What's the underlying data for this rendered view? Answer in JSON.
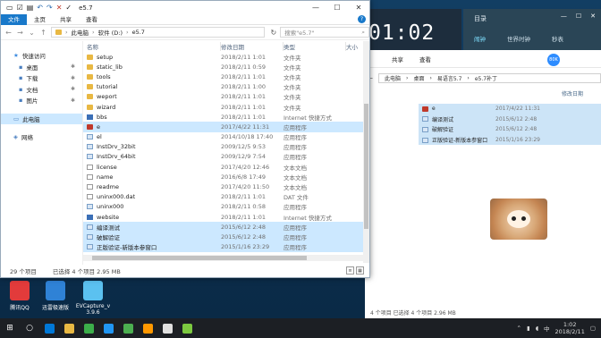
{
  "clock": {
    "time": "01:02"
  },
  "alarm": {
    "title": "目录",
    "tabs": [
      "闹钟",
      "世界时钟",
      "秒表"
    ]
  },
  "bg_window": {
    "ribbon": [
      "共享",
      "查看"
    ],
    "path": [
      "此电脑",
      "桌面",
      "易语言5.7",
      "e5.7补丁"
    ],
    "col_date": "修改日期",
    "status": "4 个项目 已选择 4 个项目 2.96 MB",
    "rows": [
      {
        "name": "e",
        "date": "2017/4/22 11:31"
      },
      {
        "name": "编译测试",
        "date": "2015/6/12 2:48"
      },
      {
        "name": "破解验证",
        "date": "2015/6/12 2:48"
      },
      {
        "name": "正版验证-新版本参窗口",
        "date": "2015/1/16 23:29"
      }
    ],
    "badge": "80K"
  },
  "window": {
    "title": "e5.7",
    "controls": {
      "min": "—",
      "max": "☐",
      "close": "✕"
    },
    "ribbon": {
      "file": "文件",
      "home": "主页",
      "share": "共享",
      "view": "查看"
    },
    "address": [
      "此电脑",
      "软件 (D:)",
      "e5.7"
    ],
    "search_placeholder": "搜索\"e5.7\"",
    "columns": {
      "name": "名称",
      "date": "修改日期",
      "type": "类型",
      "size": "大小"
    },
    "nav": [
      {
        "label": "快速访问",
        "icon": "star-icon",
        "sub": false
      },
      {
        "label": "桌面",
        "icon": "desktop-icon",
        "sub": true
      },
      {
        "label": "下载",
        "icon": "download-icon",
        "sub": true
      },
      {
        "label": "文档",
        "icon": "document-icon",
        "sub": true
      },
      {
        "label": "图片",
        "icon": "picture-icon",
        "sub": true
      },
      {
        "label": "此电脑",
        "icon": "computer-icon",
        "sub": false
      },
      {
        "label": "网络",
        "icon": "network-icon",
        "sub": false
      }
    ],
    "files": [
      {
        "name": "setup",
        "date": "2018/2/11 1:01",
        "type": "文件夹",
        "icon": "folder-icon",
        "sel": false
      },
      {
        "name": "static_lib",
        "date": "2018/2/11 0:59",
        "type": "文件夹",
        "icon": "folder-icon",
        "sel": false
      },
      {
        "name": "tools",
        "date": "2018/2/11 1:01",
        "type": "文件夹",
        "icon": "folder-icon",
        "sel": false
      },
      {
        "name": "tutorial",
        "date": "2018/2/11 1:00",
        "type": "文件夹",
        "icon": "folder-icon",
        "sel": false
      },
      {
        "name": "weport",
        "date": "2018/2/11 1:01",
        "type": "文件夹",
        "icon": "folder-icon",
        "sel": false
      },
      {
        "name": "wizard",
        "date": "2018/2/11 1:01",
        "type": "文件夹",
        "icon": "folder-icon",
        "sel": false
      },
      {
        "name": "bbs",
        "date": "2018/2/11 1:01",
        "type": "Internet 快捷方式",
        "icon": "link-icon",
        "sel": false
      },
      {
        "name": "e",
        "date": "2017/4/22 11:31",
        "type": "应用程序",
        "icon": "e-app-icon",
        "sel": true
      },
      {
        "name": "el",
        "date": "2014/10/18 17:40",
        "type": "应用程序",
        "icon": "exe-icon",
        "sel": false
      },
      {
        "name": "InstDrv_32bit",
        "date": "2009/12/5 9:53",
        "type": "应用程序",
        "icon": "exe-icon",
        "sel": false
      },
      {
        "name": "InstDrv_64bit",
        "date": "2009/12/9 7:54",
        "type": "应用程序",
        "icon": "exe-icon",
        "sel": false
      },
      {
        "name": "license",
        "date": "2017/4/20 12:46",
        "type": "文本文档",
        "icon": "doc-icon",
        "sel": false
      },
      {
        "name": "name",
        "date": "2016/6/8 17:49",
        "type": "文本文档",
        "icon": "doc-icon",
        "sel": false
      },
      {
        "name": "readme",
        "date": "2017/4/20 11:50",
        "type": "文本文档",
        "icon": "doc-icon",
        "sel": false
      },
      {
        "name": "uninx000.dat",
        "date": "2018/2/11 1:01",
        "type": "DAT 文件",
        "icon": "doc-icon",
        "sel": false
      },
      {
        "name": "uninx000",
        "date": "2018/2/11 0:58",
        "type": "应用程序",
        "icon": "exe-icon",
        "sel": false
      },
      {
        "name": "website",
        "date": "2018/2/11 1:01",
        "type": "Internet 快捷方式",
        "icon": "link-icon",
        "sel": false
      },
      {
        "name": "编译测试",
        "date": "2015/6/12 2:48",
        "type": "应用程序",
        "icon": "exe-icon",
        "sel": true
      },
      {
        "name": "破解验证",
        "date": "2015/6/12 2:48",
        "type": "应用程序",
        "icon": "exe-icon",
        "sel": true
      },
      {
        "name": "正版验证-新版本参窗口",
        "date": "2015/1/16 23:29",
        "type": "应用程序",
        "icon": "exe-icon",
        "sel": true
      }
    ],
    "status_count": "29 个项目",
    "status_selected": "已选择 4 个项目  2.95 MB"
  },
  "desktop_icons": [
    {
      "label": "腾讯QQ",
      "color": "#e23b3b"
    },
    {
      "label": "迅雷极速版",
      "color": "#2f82d6"
    },
    {
      "label": "EVCapture_v 3.9.6",
      "color": "#5bc1f0"
    }
  ],
  "taskbar": {
    "time": "1:02",
    "date": "2018/2/11",
    "lang": "中",
    "apps": [
      "#0078d7",
      "#e8b843",
      "#3cae4a",
      "#2196f3",
      "#4caf50",
      "#ff9800",
      "#e0e0e0",
      "#7cc940"
    ]
  }
}
